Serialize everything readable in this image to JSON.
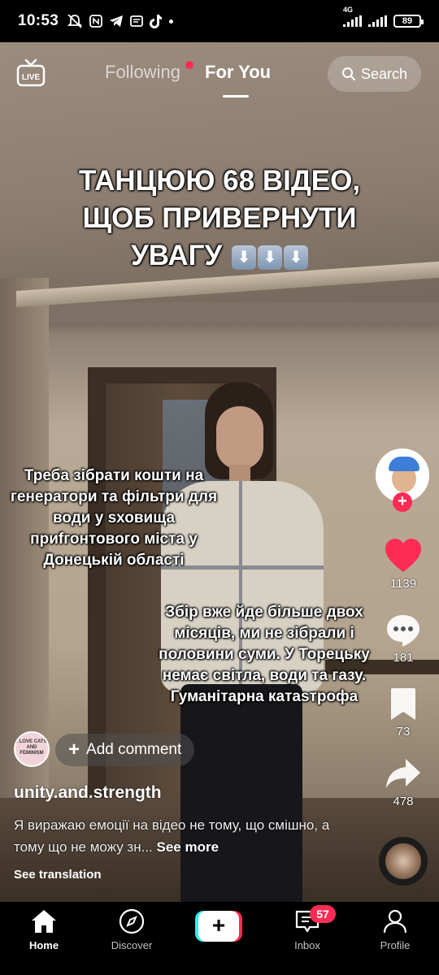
{
  "status_bar": {
    "time": "10:53",
    "network": "4G",
    "battery": "89"
  },
  "top_nav": {
    "live_label": "LIVE",
    "tabs": [
      {
        "label": "Following",
        "has_dot": true
      },
      {
        "label": "For You",
        "active": true
      }
    ],
    "search_label": "Search"
  },
  "video": {
    "caption_main_line1": "ТАНЦЮЮ 68 ВІДЕО,",
    "caption_main_line2": "ЩОБ ПРИВЕРНУТИ",
    "caption_main_line3": "УВАГУ",
    "caption_main_emoji": "⬇⬇⬇",
    "caption_left": "Треба зібрати кошти на генератори та фільтри для води у sховища приfгонтового міста у Донецькій області",
    "caption_right": "Збір вже йде більше двох місяців, ми не зібрали і половини суми. У Торецьку немає світла, води та газу. Гуманітарна катаsтрофа"
  },
  "actions": {
    "likes": "1139",
    "comments": "181",
    "bookmarks": "73",
    "shares": "478"
  },
  "post": {
    "commenter_avatar_text": "I LOVE CATS AND FEMINISM",
    "add_comment_label": "Add comment",
    "username": "unity.and.strength",
    "description": "Я виражаю емоції на відео не тому, що смішно, а тому що не можу зн...",
    "see_more": "See more",
    "see_translation": "See translation"
  },
  "bottom_nav": {
    "items": [
      {
        "label": "Home",
        "icon": "home-icon",
        "active": true
      },
      {
        "label": "Discover",
        "icon": "compass-icon"
      },
      {
        "label": "Inbox",
        "icon": "inbox-icon",
        "badge": "57"
      },
      {
        "label": "Profile",
        "icon": "profile-icon"
      }
    ]
  },
  "colors": {
    "accent_red": "#fe2c55",
    "accent_cyan": "#25f4ee"
  }
}
